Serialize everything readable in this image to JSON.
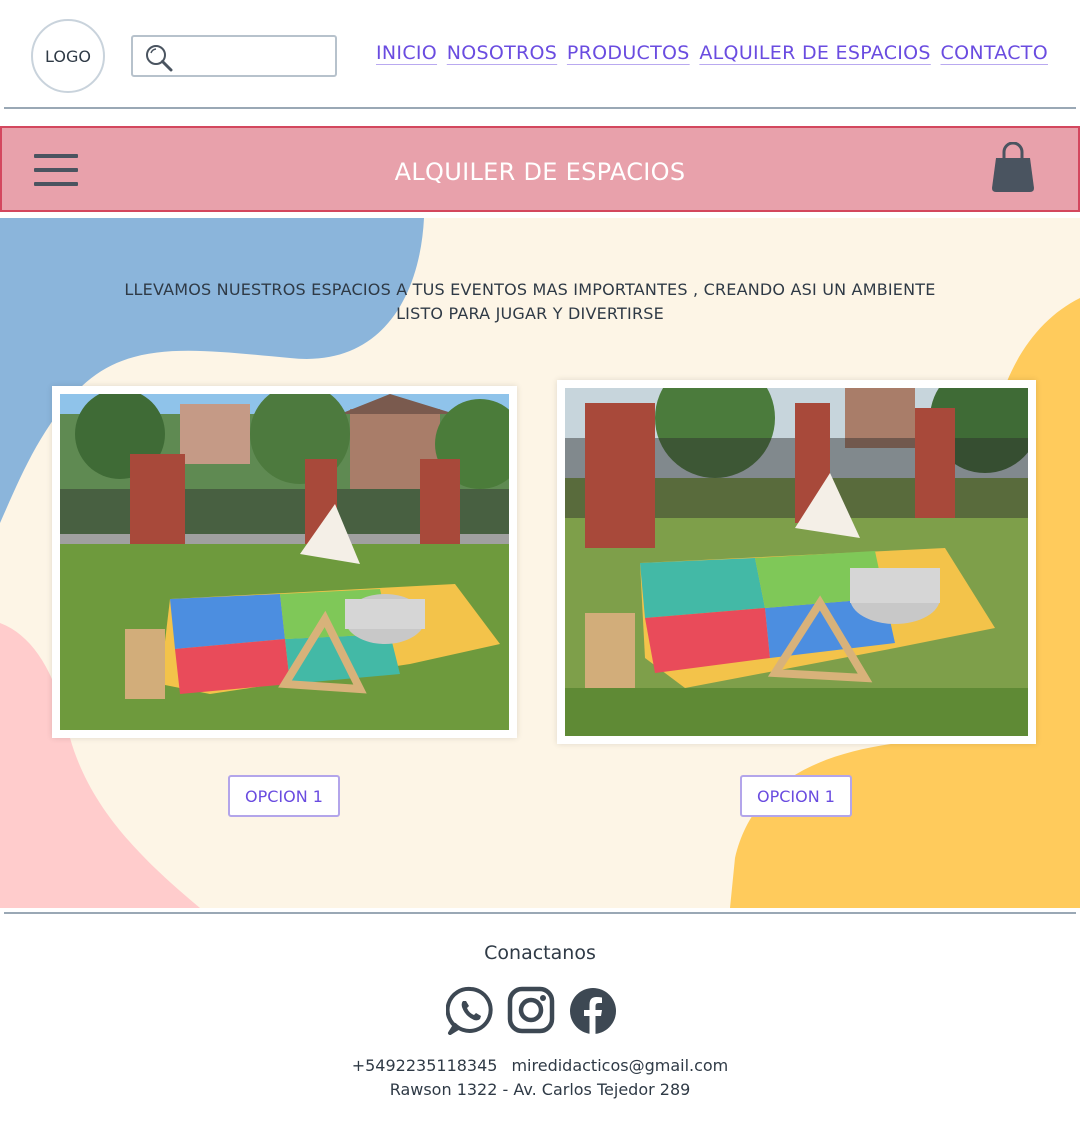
{
  "header": {
    "logo": "LOGO",
    "search": {
      "placeholder": "",
      "value": ""
    },
    "nav": [
      "INICIO",
      "NOSOTROS",
      "PRODUCTOS",
      "ALQUILER DE ESPACIOS",
      "CONTACTO"
    ]
  },
  "banner": {
    "title": "ALQUILER DE ESPACIOS",
    "menu_icon": "hamburger-icon",
    "cart_icon": "shopping-bag-icon"
  },
  "main": {
    "intro_line1": "LLEVAMOS NUESTROS ESPACIOS A TUS EVENTOS MAS IMPORTANTES , CREANDO ASI UN AMBIENTE",
    "intro_line2": "LISTO PARA JUGAR Y DIVERTIRSE",
    "cards": [
      {
        "button": "OPCION 1"
      },
      {
        "button": "OPCION 1"
      }
    ]
  },
  "footer": {
    "heading": "Conactanos",
    "phone": "+5492235118345",
    "email": "miredidacticos@gmail.com",
    "address": "Rawson 1322 - Av. Carlos Tejedor 289",
    "social_icons": [
      "whatsapp-icon",
      "instagram-icon",
      "facebook-icon"
    ]
  },
  "colors": {
    "nav_link": "#6a4ce0",
    "banner_bg": "#e8a1ab",
    "banner_border": "#d3475e",
    "hero_bg": "#fdf5e6",
    "blob_blue": "#8bb5db",
    "blob_yellow": "#ffcb5c",
    "blob_pink": "#ffcccc"
  }
}
